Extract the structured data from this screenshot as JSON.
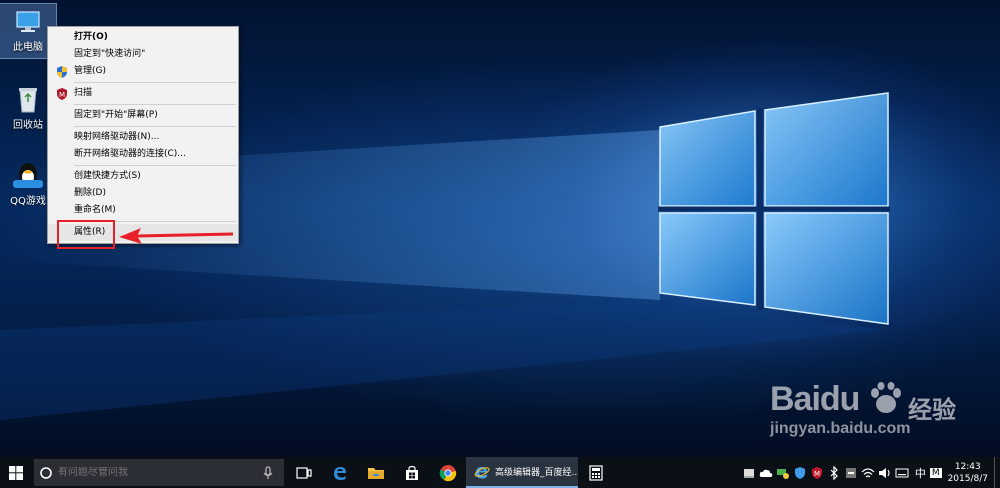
{
  "desktop": {
    "icons": [
      {
        "label": "此电脑",
        "icon": "computer-icon"
      },
      {
        "label": "回收站",
        "icon": "recycle-bin-icon"
      },
      {
        "label": "QQ游戏",
        "icon": "qq-game-icon"
      }
    ]
  },
  "context_menu": {
    "items": [
      {
        "label": "打开(O)",
        "bold": true
      },
      {
        "label": "固定到\"快速访问\""
      },
      {
        "label": "管理(G)",
        "icon": "shield-icon"
      },
      {
        "label": "扫描",
        "icon": "antivirus-icon"
      },
      {
        "label": "固定到\"开始\"屏幕(P)"
      },
      {
        "label": "映射网络驱动器(N)..."
      },
      {
        "label": "断开网络驱动器的连接(C)..."
      },
      {
        "label": "创建快捷方式(S)"
      },
      {
        "label": "删除(D)"
      },
      {
        "label": "重命名(M)"
      },
      {
        "label": "属性(R)",
        "highlighted": true
      }
    ]
  },
  "annotation": {
    "box_color": "#e8202a",
    "arrow_color": "#e8202a"
  },
  "watermark": {
    "brand": "Baidu",
    "jingyan": "经验",
    "url": "jingyan.baidu.com"
  },
  "taskbar": {
    "start_icon": "windows-logo-icon",
    "search": {
      "placeholder": "有问题尽管问我",
      "mic_icon": "microphone-icon"
    },
    "task_view_icon": "task-view-icon",
    "pinned": [
      "edge-icon",
      "file-explorer-icon",
      "store-icon",
      "chrome-icon"
    ],
    "active_app": {
      "icon": "ie-icon",
      "label": "高级编辑器_百度经..."
    },
    "calculator_icon": "calculator-icon",
    "tray": {
      "icons": [
        "antivirus-tray-icon",
        "cloud-icon",
        "network-drive-icon",
        "shield-tray-icon",
        "mcafee-icon",
        "bluetooth-icon",
        "volume-tray-icon",
        "wifi-icon",
        "speaker-icon",
        "keyboard-icon"
      ],
      "ime": "中",
      "ime_mode": "M",
      "time": "12:43",
      "date": "2015/8/7"
    }
  }
}
